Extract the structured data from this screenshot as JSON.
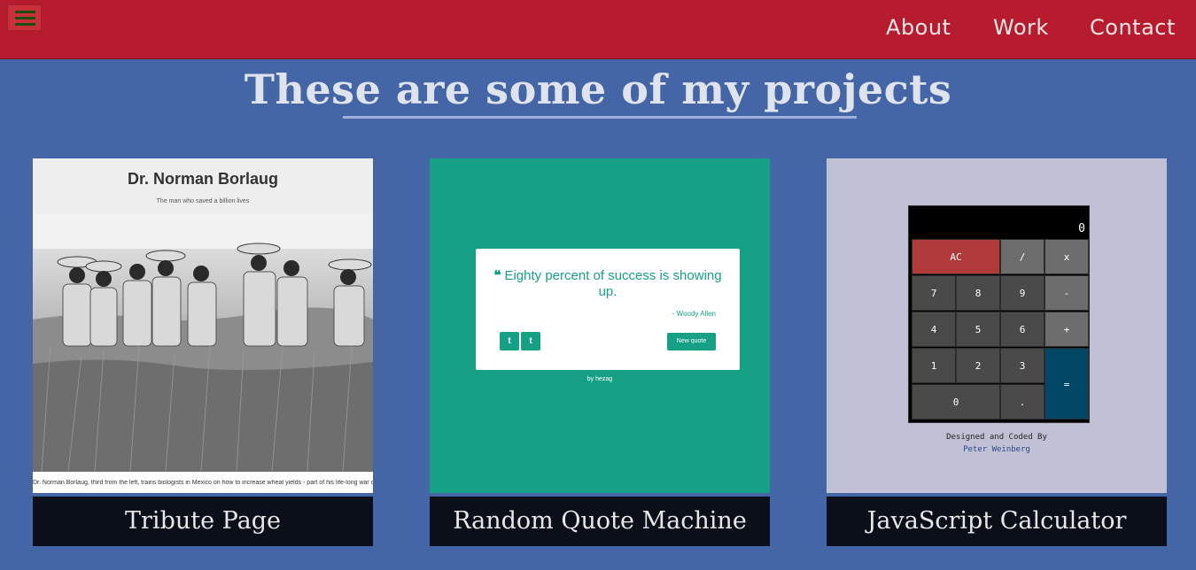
{
  "nav": {
    "links": [
      "About",
      "Work",
      "Contact"
    ]
  },
  "heading": "These are some of my projects",
  "projects": [
    {
      "caption": "Tribute Page",
      "preview": {
        "title": "Dr. Norman Borlaug",
        "subtitle": "The man who saved a billion lives",
        "photo_caption": "Dr. Norman Borlaug, third from the left, trains biologists in Mexico on how to increase wheat yields - part of his life-long war on hunger."
      }
    },
    {
      "caption": "Random Quote Machine",
      "preview": {
        "quote": "Eighty percent of success is showing up.",
        "author": "- Woody Allen",
        "twitter": "t",
        "tumblr": "t",
        "new_quote": "New quote",
        "by": "by hezag"
      }
    },
    {
      "caption": "JavaScript Calculator",
      "preview": {
        "display": "0",
        "keys": {
          "ac": "AC",
          "div": "/",
          "mul": "x",
          "k7": "7",
          "k8": "8",
          "k9": "9",
          "sub": "-",
          "k4": "4",
          "k5": "5",
          "k6": "6",
          "add": "+",
          "k1": "1",
          "k2": "2",
          "k3": "3",
          "eq": "=",
          "k0": "0",
          "dot": "."
        },
        "credit_line": "Designed and Coded By",
        "credit_name": "Peter Weinberg"
      }
    }
  ],
  "colors": {
    "background": "#4466a6",
    "navbar": "#b61c2e",
    "caption_bg": "#0b0f1a",
    "quote_green": "#16a085",
    "calc_ac": "#b03a3a",
    "calc_eq": "#004866"
  }
}
